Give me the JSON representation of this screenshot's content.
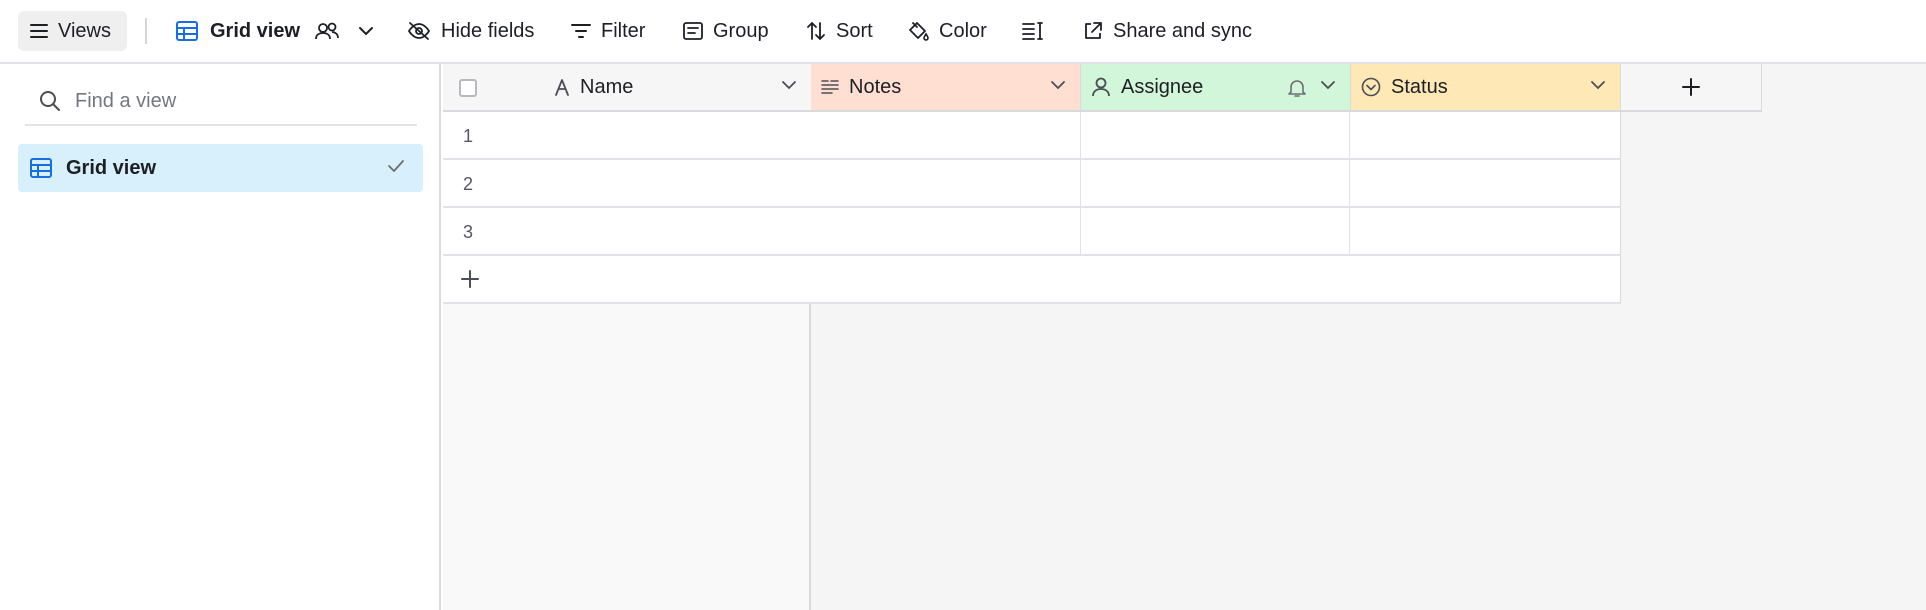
{
  "toolbar": {
    "views_label": "Views",
    "view_name": "Grid view",
    "hide_fields_label": "Hide fields",
    "filter_label": "Filter",
    "group_label": "Group",
    "sort_label": "Sort",
    "color_label": "Color",
    "share_label": "Share and sync"
  },
  "sidebar": {
    "search_placeholder": "Find a view",
    "views": [
      {
        "label": "Grid view",
        "selected": true
      }
    ]
  },
  "grid": {
    "columns": [
      {
        "label": "Name",
        "icon": "text-a-icon"
      },
      {
        "label": "Notes",
        "icon": "long-text-icon",
        "color": "#ffdfd2"
      },
      {
        "label": "Assignee",
        "icon": "user-icon",
        "color": "#d1f6d9"
      },
      {
        "label": "Status",
        "icon": "single-select-icon",
        "color": "#fde8b6"
      }
    ],
    "rows": [
      {
        "num": "1"
      },
      {
        "num": "2"
      },
      {
        "num": "3"
      }
    ]
  },
  "colors": {
    "accent_blue": "#166ee1",
    "selected_view_bg": "#d7f0fb"
  }
}
